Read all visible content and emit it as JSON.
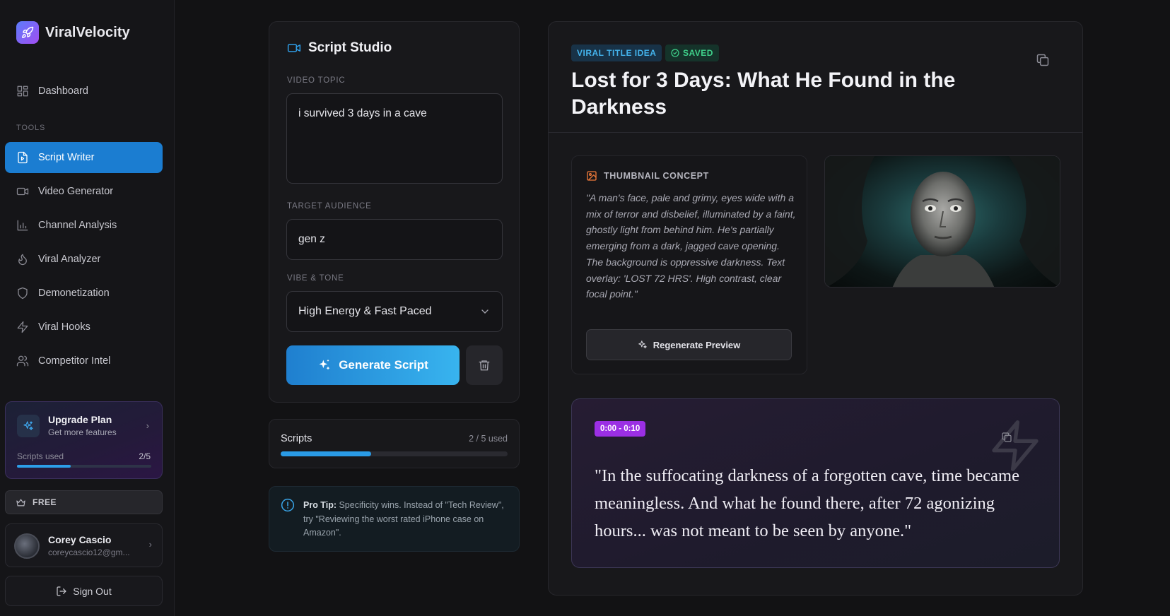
{
  "app": {
    "name": "ViralVelocity"
  },
  "sidebar": {
    "dashboard": "Dashboard",
    "tools_label": "TOOLS",
    "items": [
      {
        "label": "Script Writer",
        "icon": "file-script-icon",
        "active": true
      },
      {
        "label": "Video Generator",
        "icon": "video-camera-icon"
      },
      {
        "label": "Channel Analysis",
        "icon": "bar-chart-icon"
      },
      {
        "label": "Viral Analyzer",
        "icon": "flame-icon"
      },
      {
        "label": "Demonetization",
        "icon": "shield-icon"
      },
      {
        "label": "Viral Hooks",
        "icon": "lightning-icon"
      },
      {
        "label": "Competitor Intel",
        "icon": "users-icon"
      }
    ],
    "upgrade": {
      "title": "Upgrade Plan",
      "subtitle": "Get more features",
      "used_label": "Scripts used",
      "used_count": "2/5",
      "used_fraction": 0.4
    },
    "plan": "FREE",
    "user": {
      "name": "Corey Cascio",
      "email": "coreycascio12@gm..."
    },
    "sign_out": "Sign Out"
  },
  "studio": {
    "title": "Script Studio",
    "topic_label": "VIDEO TOPIC",
    "topic_value": "i survived 3 days in a cave",
    "audience_label": "TARGET AUDIENCE",
    "audience_value": "gen z",
    "tone_label": "VIBE & TONE",
    "tone_value": "High Energy & Fast Paced",
    "generate_label": "Generate Script"
  },
  "usage": {
    "label": "Scripts",
    "count": "2 / 5 used",
    "fraction": 0.4
  },
  "tip": {
    "prefix": "Pro Tip:",
    "text": " Specificity wins. Instead of \"Tech Review\", try \"Reviewing the worst rated iPhone case on Amazon\"."
  },
  "result": {
    "tag_viral": "VIRAL TITLE IDEA",
    "tag_saved": "SAVED",
    "title": "Lost for 3 Days: What He Found in the Darkness",
    "thumbnail": {
      "label": "THUMBNAIL CONCEPT",
      "description": "\"A man's face, pale and grimy, eyes wide with a mix of terror and disbelief, illuminated by a faint, ghostly light from behind him. He's partially emerging from a dark, jagged cave opening. The background is oppressive darkness. Text overlay: 'LOST 72 HRS'. High contrast, clear focal point.\"",
      "regenerate_label": "Regenerate Preview"
    },
    "segment": {
      "time": "0:00 - 0:10",
      "quote": "\"In the suffocating darkness of a forgotten cave, time became meaningless. And what he found there, after 72 agonizing hours... was not meant to be seen by anyone.\""
    }
  },
  "colors": {
    "accent": "#1b7dd1",
    "segment_badge": "#9b2fe4",
    "saved": "#3fd08a"
  }
}
